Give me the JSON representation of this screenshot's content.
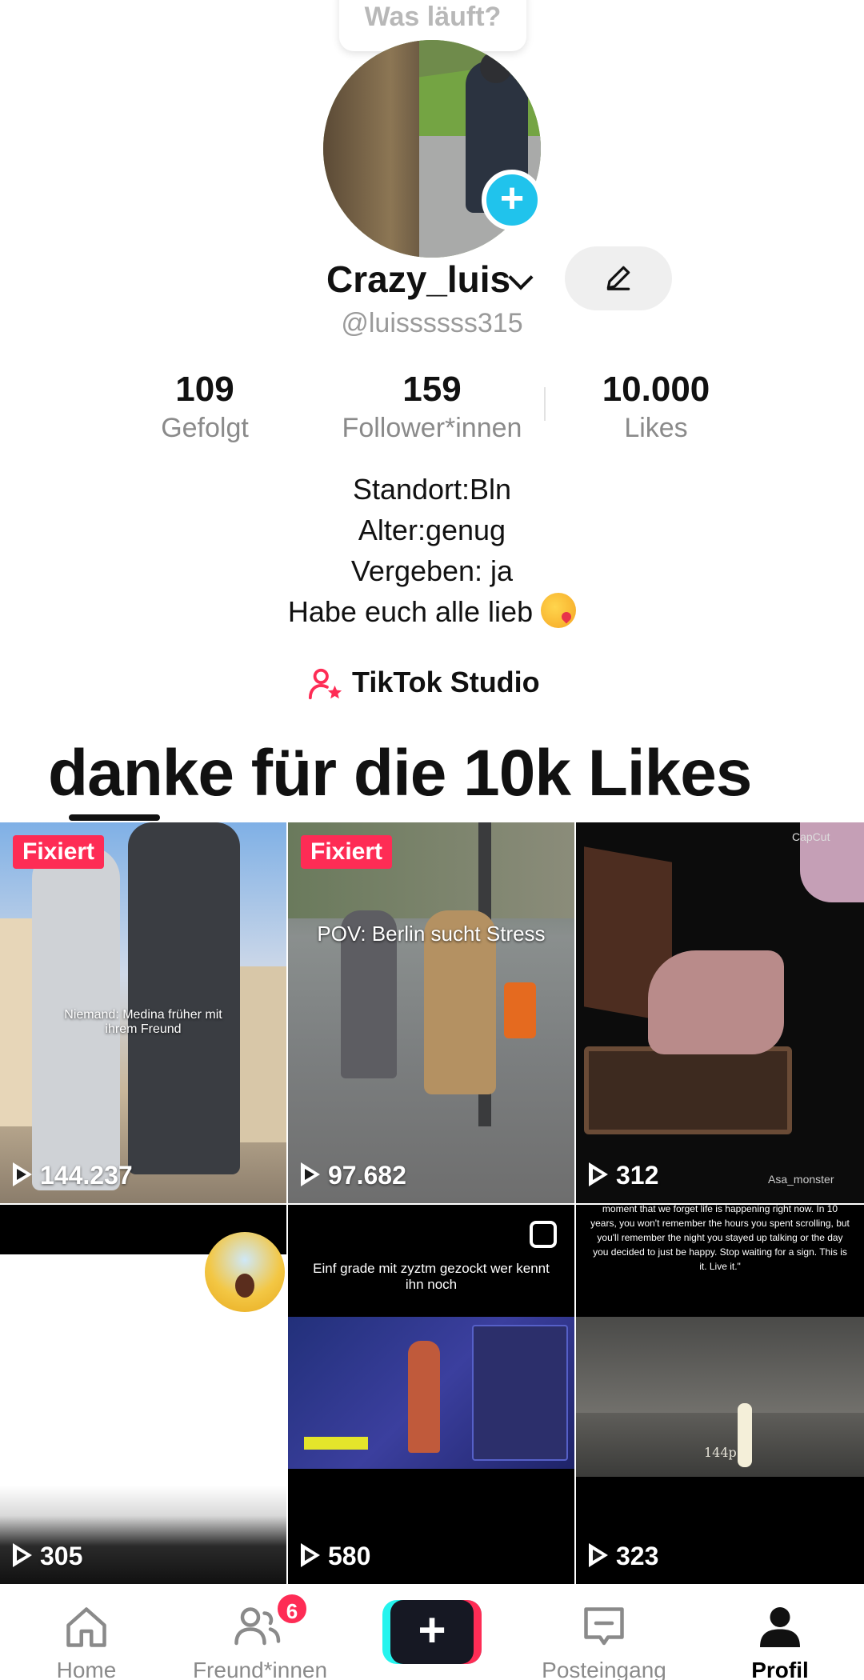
{
  "story": {
    "bubble_text": "Was läuft?"
  },
  "profile": {
    "name": "Crazy_luis",
    "handle": "@luissssss315"
  },
  "stats": [
    {
      "value": "109",
      "label": "Gefolgt"
    },
    {
      "value": "159",
      "label": "Follower*innen"
    },
    {
      "value": "10.000",
      "label": "Likes"
    }
  ],
  "bio": [
    "Standort:Bln",
    "Alter:genug",
    "Vergeben: ja",
    "Habe euch alle lieb"
  ],
  "studio": {
    "label": "TikTok Studio"
  },
  "overlay_caption": "danke für die 10k Likes",
  "videos": [
    {
      "views": "144.237",
      "pinned": "Fixiert",
      "text": "Niemand: Medina früher mit ihrem Freund"
    },
    {
      "views": "97.682",
      "pinned": "Fixiert",
      "text": "POV: Berlin sucht Stress"
    },
    {
      "views": "312",
      "watermark": "CapCut",
      "credit": "Asa_monster"
    },
    {
      "views": "305"
    },
    {
      "views": "580",
      "text": "Einf grade mit zyztm gezockt wer kennt ihn noch"
    },
    {
      "views": "323",
      "text": "moment that we forget life is happening right now. In 10 years, you won't remember the hours you spent scrolling, but you'll remember the night you stayed up talking or the day you decided to just be happy. Stop waiting for a sign. This is it. Live it.\"",
      "quality": "144p"
    }
  ],
  "nav": {
    "home": "Home",
    "friends": "Freund*innen",
    "friends_badge": "6",
    "inbox": "Posteingang",
    "profile": "Profil"
  },
  "colors": {
    "accent": "#fe2c55",
    "cyan": "#25f4ee",
    "plus_badge": "#20c3ec"
  }
}
